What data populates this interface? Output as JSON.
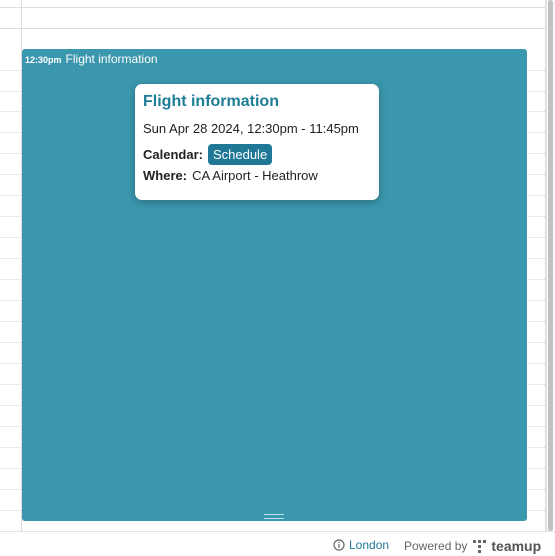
{
  "event": {
    "time": "12:30pm",
    "title": "Flight information",
    "color": "#3b97ad"
  },
  "popover": {
    "title": "Flight information",
    "datetime": "Sun Apr 28 2024, 12:30pm - 11:45pm",
    "calendar_label": "Calendar:",
    "calendar_value": "Schedule",
    "where_label": "Where:",
    "where_value": "CA Airport - Heathrow",
    "accent": "#1e7896"
  },
  "footer": {
    "timezone_icon": "info-icon",
    "timezone": "London",
    "powered_by": "Powered by",
    "brand_icon": "teamup-logo-icon",
    "brand": "teamup"
  }
}
